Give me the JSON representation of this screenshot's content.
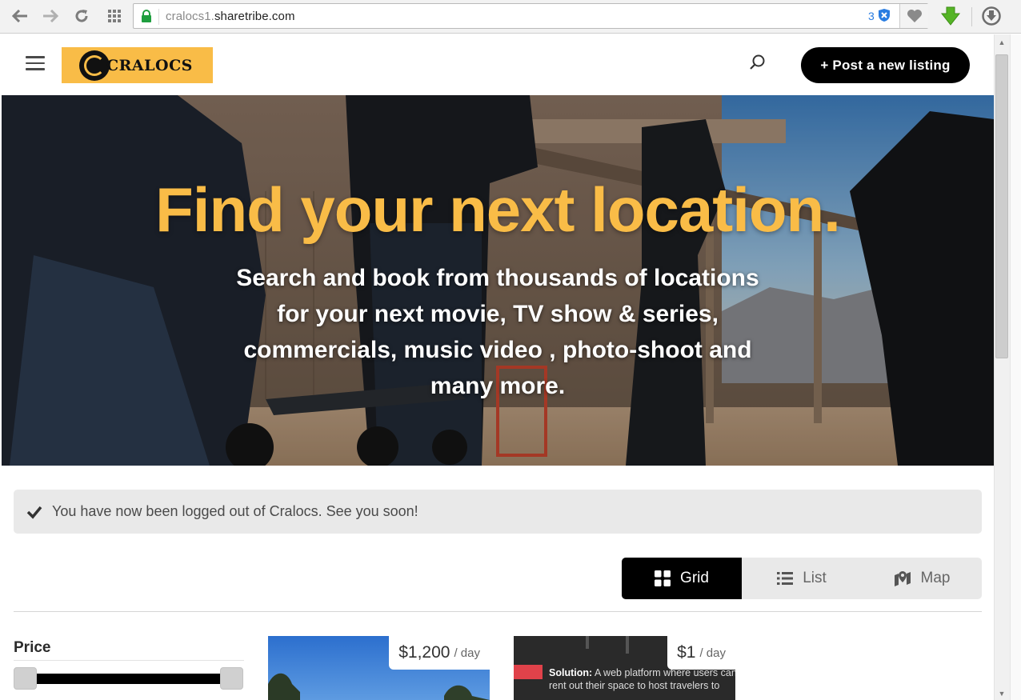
{
  "browser": {
    "url_prefix": "cralocs1.",
    "url_domain": "sharetribe.com",
    "extension_count": "3"
  },
  "header": {
    "logo_text": "CRALOCS",
    "post_button_label": "+ Post a new listing"
  },
  "hero": {
    "title": "Find your next location.",
    "subtitle": "Search and book from thousands of locations for your next movie, TV show & series, commercials, music video , photo-shoot and many more."
  },
  "flash": {
    "message": "You have now been logged out of Cralocs. See you soon!"
  },
  "view_toggle": {
    "options": [
      {
        "label": "Grid",
        "icon": "grid-icon",
        "active": true
      },
      {
        "label": "List",
        "icon": "list-icon",
        "active": false
      },
      {
        "label": "Map",
        "icon": "map-icon",
        "active": false
      }
    ]
  },
  "filters": {
    "price_label": "Price",
    "price_range": [
      0,
      1
    ]
  },
  "listings": [
    {
      "price": "$1,200",
      "unit": "/ day"
    },
    {
      "price": "$1",
      "unit": "/ day",
      "caption_bold": "Solution:",
      "caption_text": " A web platform where users can rent out their space to host travelers to"
    }
  ],
  "colors": {
    "accent": "#f9bc47",
    "button": "#000000",
    "flash_bg": "#e9e9e9"
  }
}
